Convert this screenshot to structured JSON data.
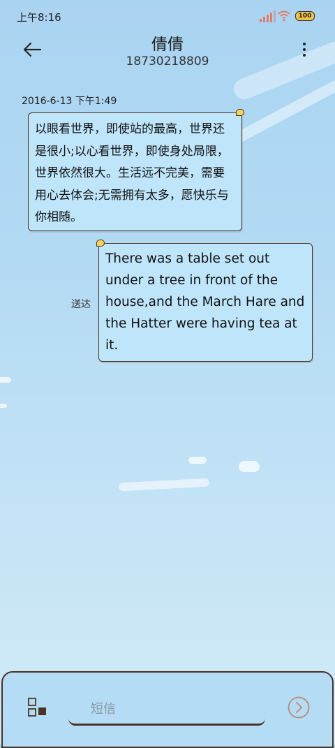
{
  "status_bar": {
    "time": "上午8:16",
    "battery": "100"
  },
  "header": {
    "contact_name": "倩倩",
    "phone_number": "18730218809"
  },
  "conversation": {
    "timestamp": "2016-6-13 下午1:49",
    "messages": [
      {
        "direction": "incoming",
        "text": "以眼看世界，即使站的最高，世界还是很小;以心看世界，即使身处局限，世界依然很大。生活远不完美，需要用心去体会;无需拥有太多，愿快乐与你相随。"
      },
      {
        "direction": "outgoing",
        "text": "There was a table set out under a tree in front of the house,and the March Hare and the Hatter were having tea at it.",
        "status": "送达"
      }
    ]
  },
  "composer": {
    "placeholder": "短信"
  },
  "icons": {
    "back": "arrow-left-icon",
    "menu": "more-vertical-icon",
    "attach": "attachment-grid-icon",
    "send": "send-chevron-icon"
  },
  "colors": {
    "bubble_fill": "#bfe5fa",
    "bubble_border": "#4b3326",
    "background": "#b3daf3"
  }
}
